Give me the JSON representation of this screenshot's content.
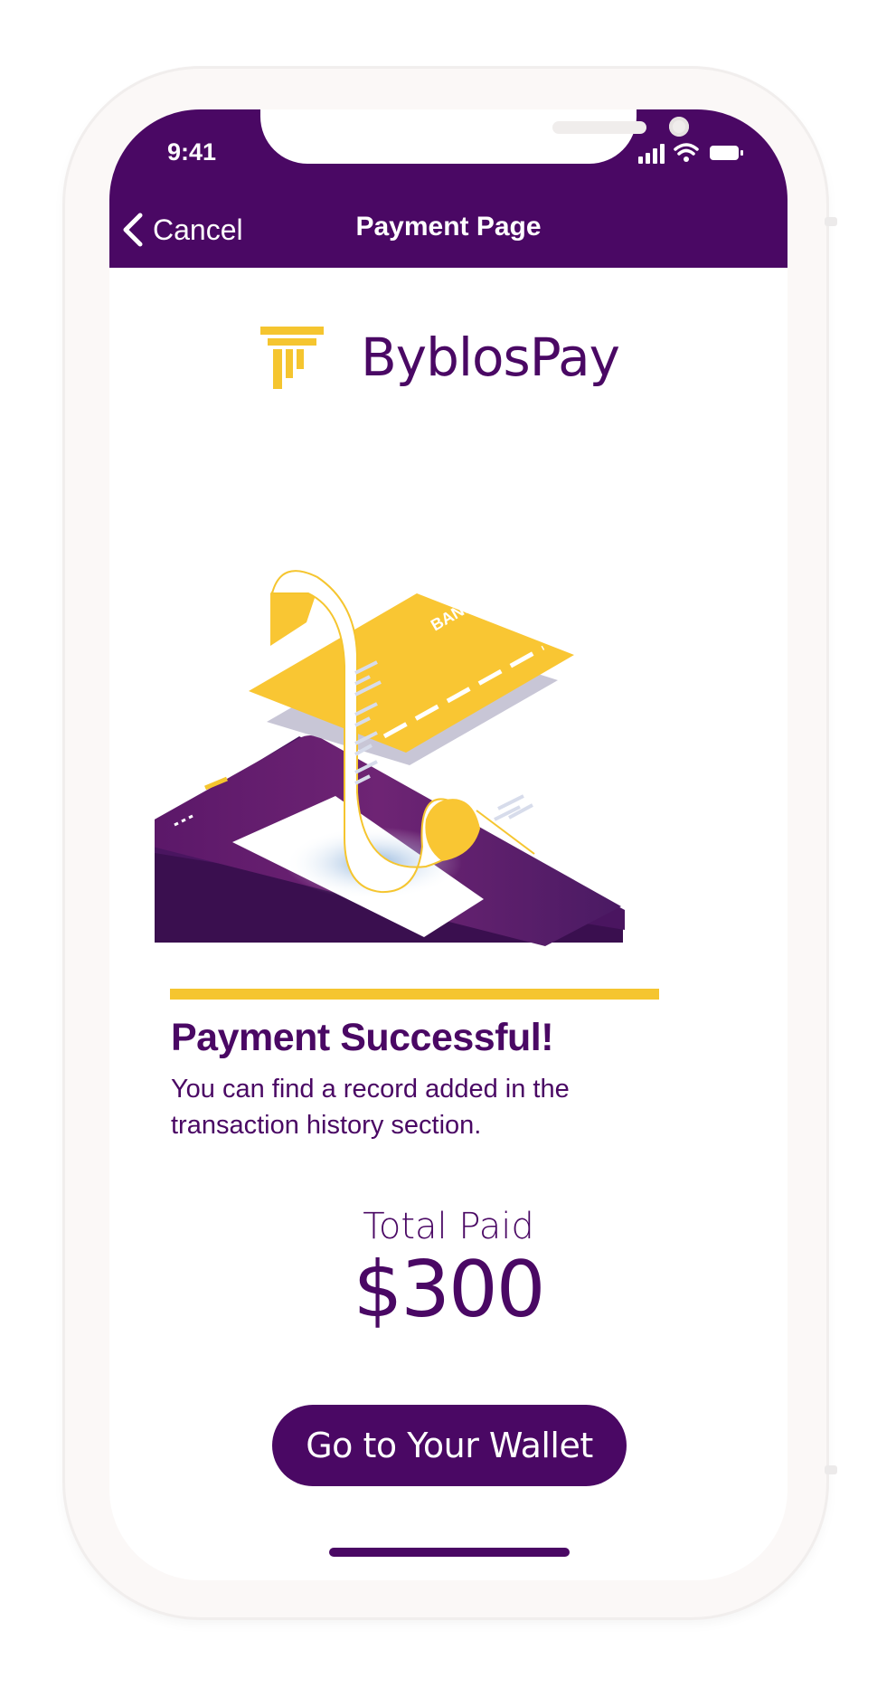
{
  "status_bar": {
    "time": "9:41"
  },
  "header": {
    "cancel_label": "Cancel",
    "title": "Payment Page"
  },
  "brand": {
    "name": "ByblosPay"
  },
  "illustration": {
    "card_label": "BANK"
  },
  "result": {
    "title": "Payment Successful!",
    "message": "You can find a record added in the transaction history section."
  },
  "total": {
    "label": "Total Paid",
    "amount": "$300"
  },
  "actions": {
    "wallet_button": "Go to Your Wallet"
  },
  "colors": {
    "primary": "#4a0864",
    "accent": "#f5c52f",
    "background": "#ffffff"
  },
  "icons": {
    "back": "chevron-left-icon",
    "signal": "cellular-signal-icon",
    "wifi": "wifi-icon",
    "battery": "battery-icon",
    "logo": "pillar-logo-icon"
  }
}
